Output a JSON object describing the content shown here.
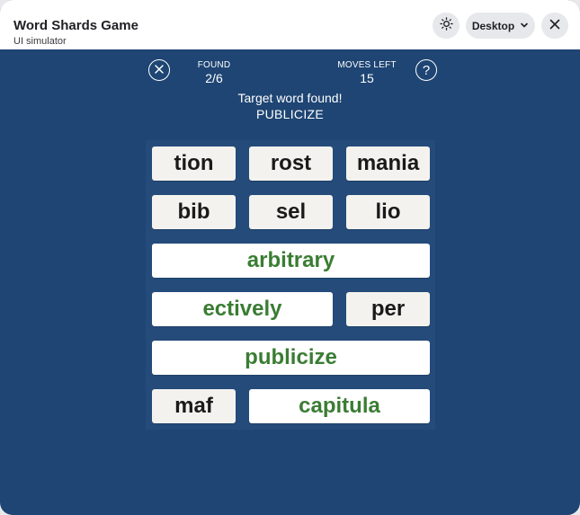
{
  "window": {
    "title": "Word Shards Game",
    "subtitle": "UI simulator",
    "device_label": "Desktop"
  },
  "stats": {
    "found_label": "FOUND",
    "found_value": "2/6",
    "moves_label": "MOVES LEFT",
    "moves_value": "15"
  },
  "message": {
    "line1": "Target word found!",
    "line2": "PUBLICIZE"
  },
  "tiles": [
    {
      "text": "tion",
      "found": false
    },
    {
      "text": "rost",
      "found": false
    },
    {
      "text": "mania",
      "found": false
    },
    {
      "text": "bib",
      "found": false
    },
    {
      "text": "sel",
      "found": false
    },
    {
      "text": "lio",
      "found": false
    },
    {
      "text": "arbitrary",
      "found": true
    },
    {
      "text": "ectively",
      "found": true
    },
    {
      "text": "per",
      "found": false
    },
    {
      "text": "publicize",
      "found": true
    },
    {
      "text": "maf",
      "found": false
    },
    {
      "text": "capitula",
      "found": true
    }
  ],
  "colors": {
    "background": "#1e4573",
    "found_text": "#3a7d33",
    "tile_bg": "#f4f2ee"
  },
  "icons": {
    "theme": "sun-icon",
    "device_chevron": "chevron-down-icon",
    "close": "close-icon",
    "exit": "circle-x-icon",
    "help": "help-icon"
  }
}
